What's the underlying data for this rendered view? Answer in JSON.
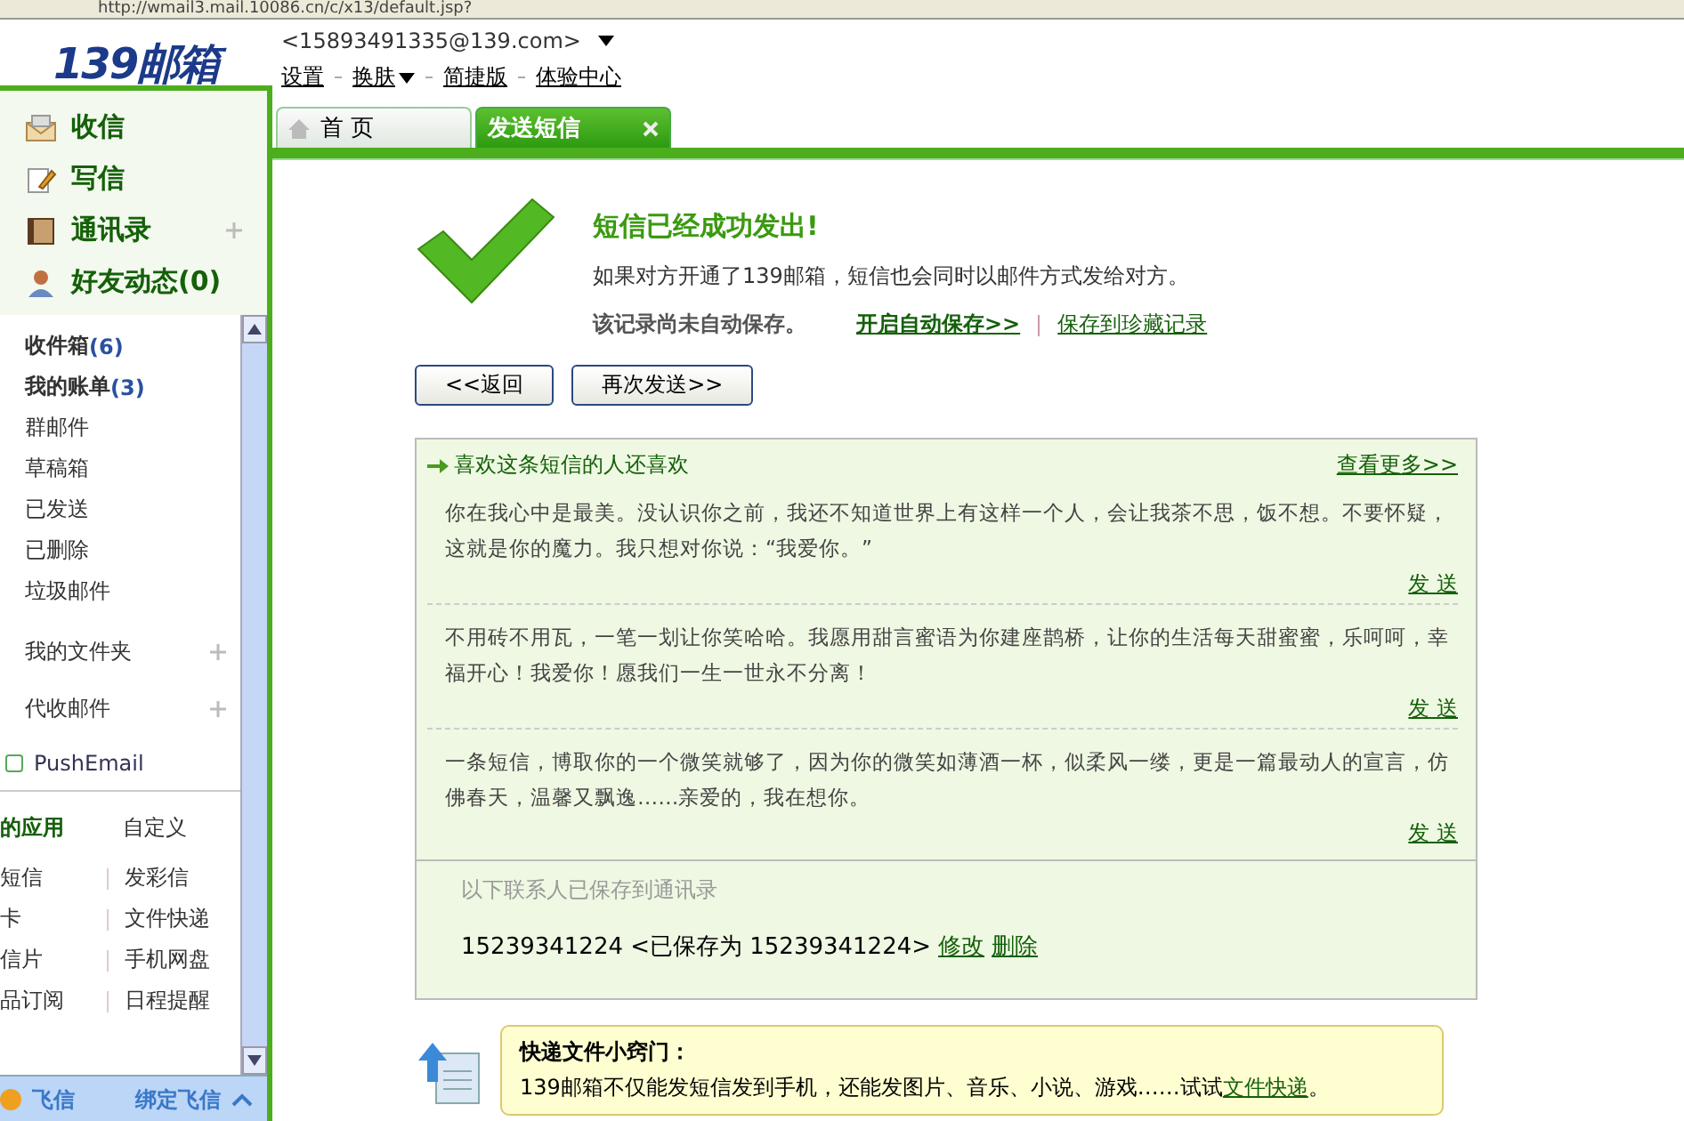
{
  "browser": {
    "address": "http://wmail3.mail.10086.cn/c/x13/default.jsp?"
  },
  "header": {
    "logo": "139邮箱",
    "account": "<15893491335@139.com>",
    "links": [
      {
        "label": "设置",
        "kind": "link"
      },
      {
        "label": "换肤",
        "kind": "dropdown"
      },
      {
        "label": "简捷版",
        "kind": "link"
      },
      {
        "label": "体验中心",
        "kind": "link"
      }
    ]
  },
  "tabs": [
    {
      "label": "首 页",
      "selected": false
    },
    {
      "label": "发送短信",
      "selected": true
    }
  ],
  "sidebar": {
    "main_items": [
      {
        "label": "收信",
        "kind": "inbox",
        "expandable": false
      },
      {
        "label": "写信",
        "kind": "compose",
        "expandable": false
      },
      {
        "label": "通讯录",
        "kind": "contacts",
        "expandable": true
      },
      {
        "label": "好友动态(0)",
        "kind": "friends",
        "expandable": false
      }
    ],
    "folders": [
      {
        "label": "收件箱",
        "count": "(6)"
      },
      {
        "label": "我的账单",
        "count": "(3)"
      },
      {
        "label": "群邮件"
      },
      {
        "label": "草稿箱"
      },
      {
        "label": "已发送"
      },
      {
        "label": "已删除"
      },
      {
        "label": "垃圾邮件"
      }
    ],
    "groups": [
      {
        "label": "我的文件夹"
      },
      {
        "label": "代收邮件"
      }
    ],
    "push": "PushEmail",
    "apps": {
      "title": "的应用",
      "customize": "自定义",
      "rows": [
        {
          "left": "短信",
          "right": "发彩信"
        },
        {
          "left": "卡",
          "right": "文件快递"
        },
        {
          "left": "信片",
          "right": "手机网盘"
        },
        {
          "left": "品订阅",
          "right": "日程提醒"
        }
      ]
    },
    "fetion": {
      "title": "飞信",
      "bind": "绑定飞信"
    }
  },
  "result": {
    "title": "短信已经成功发出!",
    "note": "如果对方开通了139邮箱，短信也会同时以邮件方式发给对方。",
    "save_status": "该记录尚未自动保存。",
    "links": [
      "开启自动保存>>",
      "保存到珍藏记录"
    ],
    "buttons": [
      "<<返回",
      "再次发送>>"
    ]
  },
  "recommend": {
    "title": "喜欢这条短信的人还喜欢",
    "more": "查看更多>>",
    "messages": [
      {
        "text": "你在我心中是最美。没认识你之前，我还不知道世界上有这样一个人，会让我茶不思，饭不想。不要怀疑，这就是你的魔力。我只想对你说：“我爱你。”",
        "action": "发 送"
      },
      {
        "text": "不用砖不用瓦，一笔一划让你笑哈哈。我愿用甜言蜜语为你建座鹊桥，让你的生活每天甜蜜蜜，乐呵呵，幸福开心！我爱你！愿我们一生一世永不分离！",
        "action": "发 送"
      },
      {
        "text": "一条短信，博取你的一个微笑就够了，因为你的微笑如薄酒一杯，似柔风一缕，更是一篇最动人的宣言，仿佛春天，温馨又飘逸……亲爱的，我在想你。",
        "action": "发 送"
      }
    ]
  },
  "contacts": {
    "title": "以下联系人已保存到通讯录",
    "entries": [
      {
        "text": "15239341224 <已保存为 15239341224>",
        "edit": "修改",
        "delete": "删除"
      }
    ]
  },
  "tip": {
    "title": "快递文件小窍门：",
    "text": "139邮箱不仅能发短信发到手机，还能发图片、音乐、小说、游戏……试试",
    "link": "文件快递",
    "end": "。"
  }
}
